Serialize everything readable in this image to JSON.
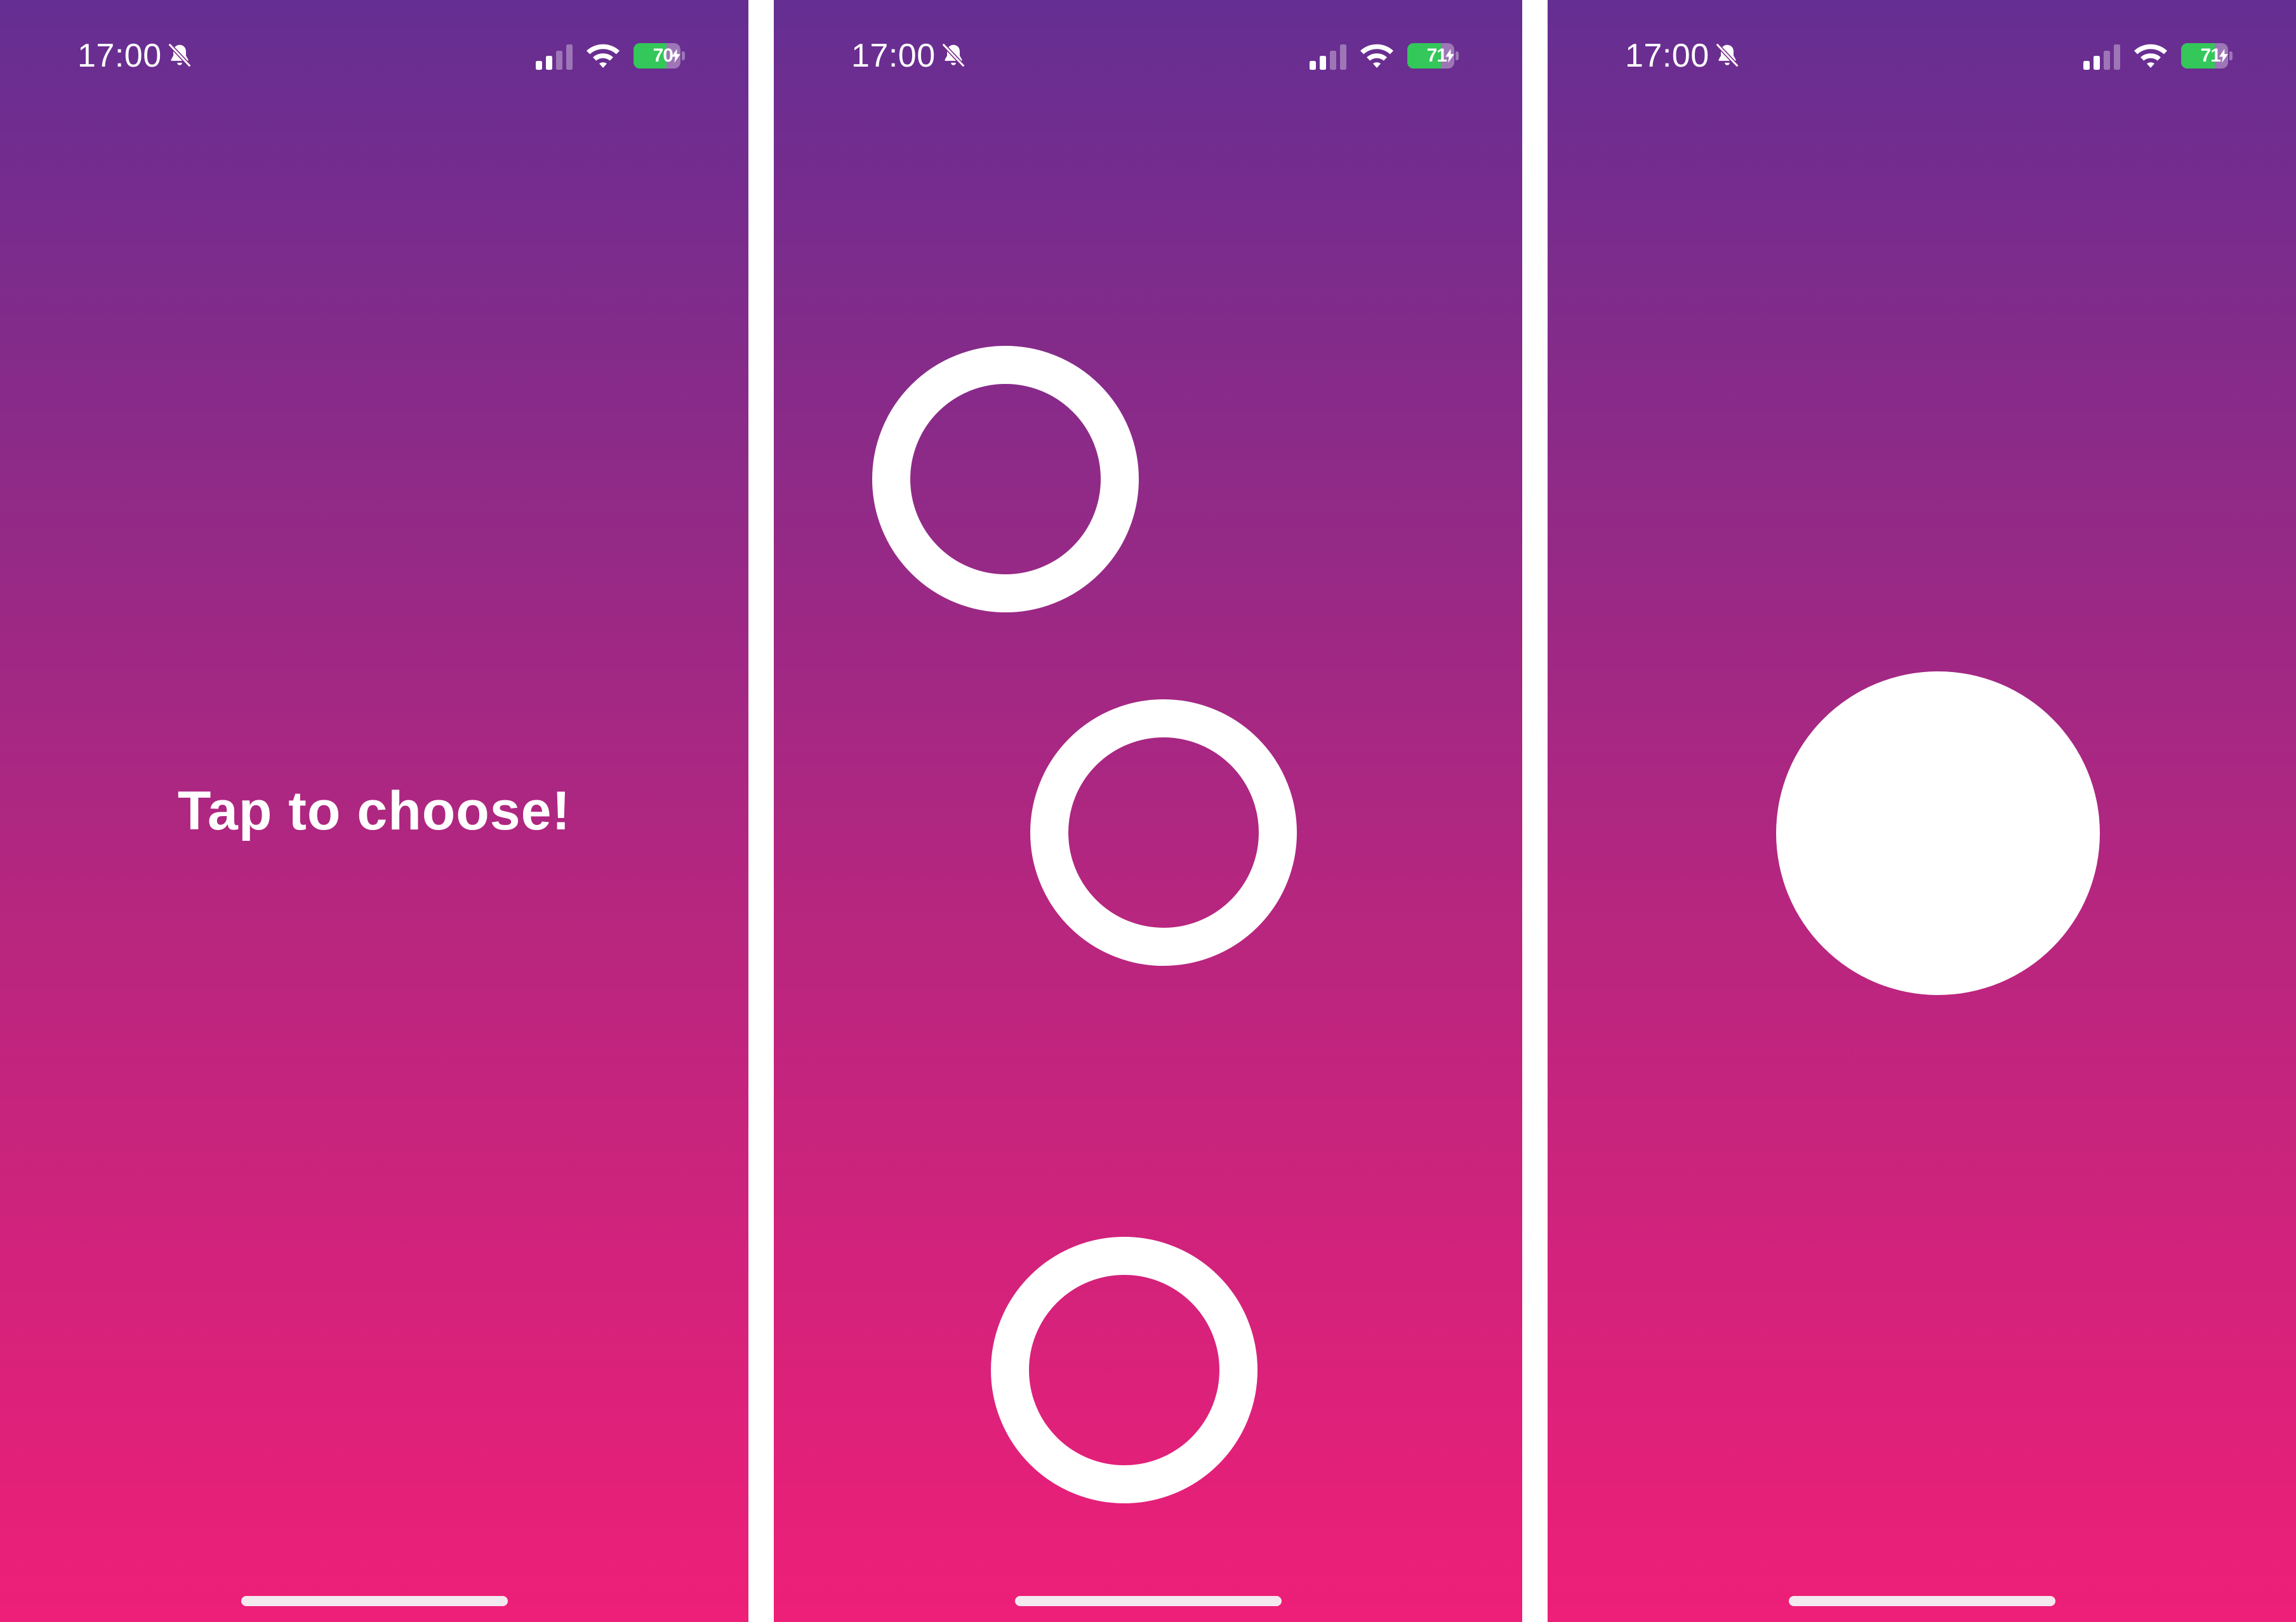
{
  "screens": [
    {
      "status_bar": {
        "time": "17:00",
        "battery_percent": "70",
        "battery_level": 0.7,
        "charging": true,
        "silent_mode": true
      },
      "prompt": "Tap to choose!"
    },
    {
      "status_bar": {
        "time": "17:00",
        "battery_percent": "71",
        "battery_level": 0.71,
        "charging": true,
        "silent_mode": true
      },
      "touch_indicators": 3
    },
    {
      "status_bar": {
        "time": "17:00",
        "battery_percent": "71",
        "battery_level": 0.71,
        "charging": true,
        "silent_mode": true
      },
      "chosen_indicators": 1
    }
  ],
  "icons": {
    "silent": "bell-slash-icon",
    "signal": "cellular-signal-icon",
    "wifi": "wifi-icon",
    "battery": "battery-icon",
    "charging": "bolt-icon"
  },
  "colors": {
    "gradient_top": "#652e92",
    "gradient_bottom": "#ee1f78",
    "battery_fill": "#34c759",
    "foreground": "#ffffff"
  }
}
